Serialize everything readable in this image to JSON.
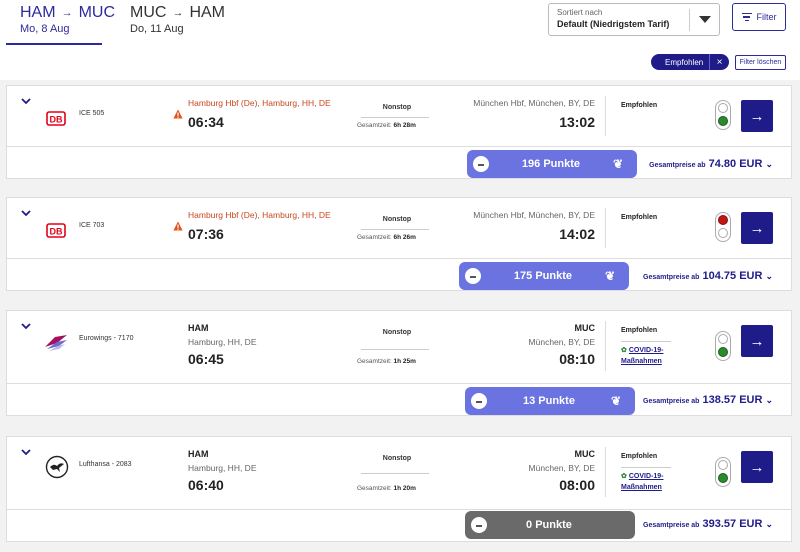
{
  "tabs": [
    {
      "route_from": "HAM",
      "route_to": "MUC",
      "arrow": "→",
      "date": "Mo, 8 Aug"
    },
    {
      "route_from": "MUC",
      "route_to": "HAM",
      "arrow": "→",
      "date": "Do, 11 Aug"
    }
  ],
  "sort": {
    "caption": "Sortiert nach",
    "value": "Default (Niedrigstem Tarif)"
  },
  "filter_button": {
    "label": "Filter"
  },
  "active_filter": {
    "label": "Empfohlen",
    "remove": "×"
  },
  "clear_filter": {
    "label": "Filter löschen"
  },
  "results": [
    {
      "carrier": "DB",
      "flight_no": "ICE 505",
      "departure": {
        "name": "Hamburg Hbf (De), Hamburg, HH, DE",
        "time": "06:34",
        "warning": true
      },
      "stops": "Nonstop",
      "duration_label": "Gesamtzeit:",
      "duration": "6h 28m",
      "arrival": {
        "name": "München Hbf, München, BY, DE",
        "time": "13:02"
      },
      "tag": "Empfohlen",
      "light": "green",
      "points": "196 Punkte",
      "price_prefix": "Gesamtpreise ab",
      "price": "74.80 EUR"
    },
    {
      "carrier": "DB",
      "flight_no": "ICE 703",
      "departure": {
        "name": "Hamburg Hbf (De), Hamburg, HH, DE",
        "time": "07:36",
        "warning": true
      },
      "stops": "Nonstop",
      "duration_label": "Gesamtzeit:",
      "duration": "6h 26m",
      "arrival": {
        "name": "München Hbf, München, BY, DE",
        "time": "14:02"
      },
      "tag": "Empfohlen",
      "light": "red",
      "points": "175 Punkte",
      "price_prefix": "Gesamtpreise ab",
      "price": "104.75 EUR"
    },
    {
      "carrier": "Eurowings",
      "flight_no": "Eurowings - 7170",
      "departure": {
        "code": "HAM",
        "city": "Hamburg, HH, DE",
        "time": "06:45"
      },
      "stops": "Nonstop",
      "duration_label": "Gesamtzeit:",
      "duration": "1h 25m",
      "arrival": {
        "code": "MUC",
        "city": "München, BY, DE",
        "time": "08:10"
      },
      "tag": "Empfohlen",
      "covid": "COVID-19-Maßnahmen",
      "light": "green",
      "points": "13 Punkte",
      "price_prefix": "Gesamtpreise ab",
      "price": "138.57 EUR"
    },
    {
      "carrier": "Lufthansa",
      "flight_no": "Lufthansa - 2083",
      "departure": {
        "code": "HAM",
        "city": "Hamburg, HH, DE",
        "time": "06:40"
      },
      "stops": "Nonstop",
      "duration_label": "Gesamtzeit:",
      "duration": "1h 20m",
      "arrival": {
        "code": "MUC",
        "city": "München, BY, DE",
        "time": "08:00"
      },
      "tag": "Empfohlen",
      "covid": "COVID-19-Maßnahmen",
      "light": "green",
      "points": "0 Punkte",
      "price_prefix": "Gesamtpreise ab",
      "price": "393.57 EUR"
    }
  ],
  "colors": {
    "brand": "#1f1c8a",
    "points": "#6a73e0",
    "points_zero": "#6a6a6a",
    "warning": "#c8481f"
  }
}
